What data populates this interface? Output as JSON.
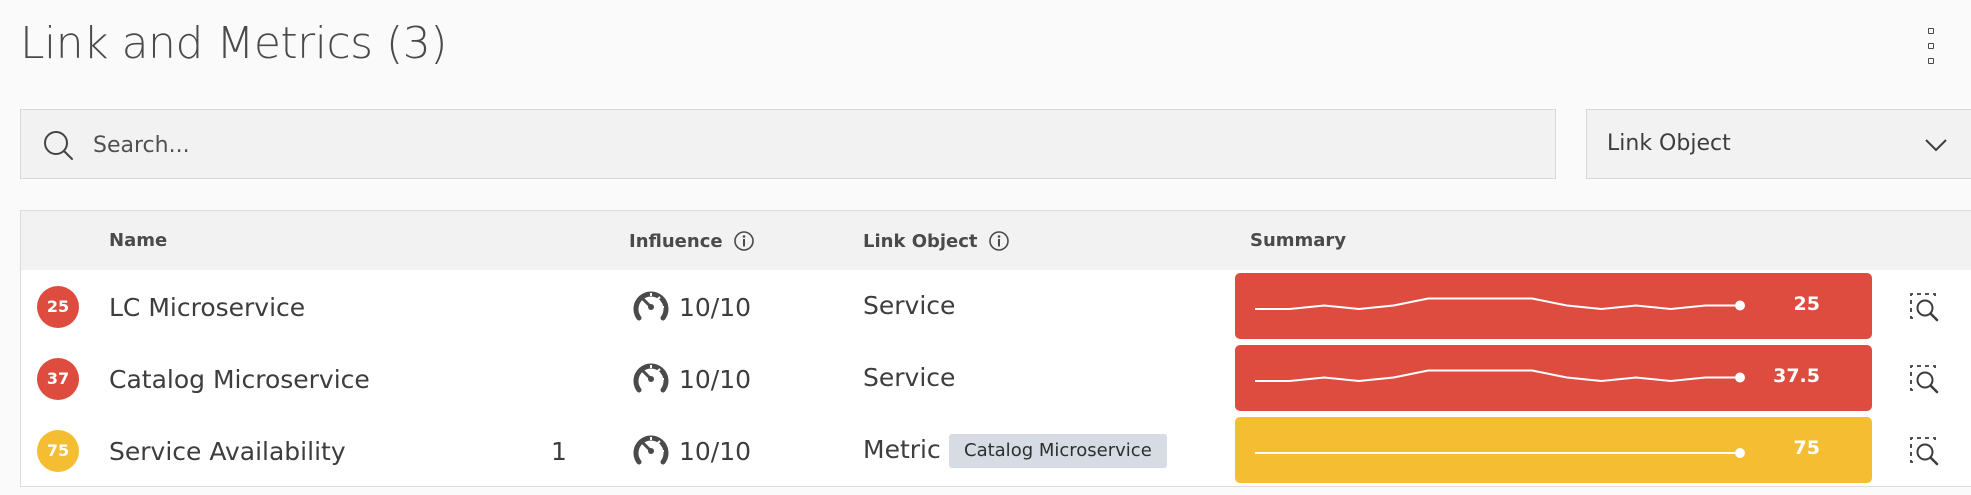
{
  "header": {
    "title": "Link and Metrics (3)",
    "menu_icon": "kebab-menu-icon"
  },
  "search": {
    "placeholder": "Search...",
    "value": "",
    "icon": "search-icon"
  },
  "filter": {
    "selected": "Link Object",
    "icon": "chevron-down-icon"
  },
  "table": {
    "columns": {
      "name": "Name",
      "influence": "Influence",
      "link_object": "Link Object",
      "summary": "Summary"
    },
    "rows": [
      {
        "score": "25",
        "score_color": "#de4b3f",
        "name": "LC Microservice",
        "count": "",
        "influence": "10/10",
        "link_object": "Service",
        "tag": "",
        "summary_value": "25",
        "summary_color": "#de4b3f",
        "sparkline": [
          1,
          1,
          2,
          1,
          2,
          4,
          4,
          4,
          4,
          2,
          1,
          2,
          1,
          2,
          2
        ]
      },
      {
        "score": "37",
        "score_color": "#de4b3f",
        "name": "Catalog Microservice",
        "count": "",
        "influence": "10/10",
        "link_object": "Service",
        "tag": "",
        "summary_value": "37.5",
        "summary_color": "#de4b3f",
        "sparkline": [
          1,
          1,
          2,
          1,
          2,
          4,
          4,
          4,
          4,
          2,
          1,
          2,
          1,
          2,
          2
        ]
      },
      {
        "score": "75",
        "score_color": "#f5bd31",
        "name": "Service Availability",
        "count": "1",
        "influence": "10/10",
        "link_object": "Metric",
        "tag": "Catalog Microservice",
        "summary_value": "75",
        "summary_color": "#f5bd31",
        "sparkline": [
          1,
          1,
          1,
          1,
          1,
          1,
          1,
          1,
          1,
          1,
          1,
          1,
          1,
          1,
          1
        ]
      }
    ]
  },
  "icons": {
    "influence": "gauge-icon",
    "info": "info-icon",
    "row_action": "details-search-icon"
  }
}
